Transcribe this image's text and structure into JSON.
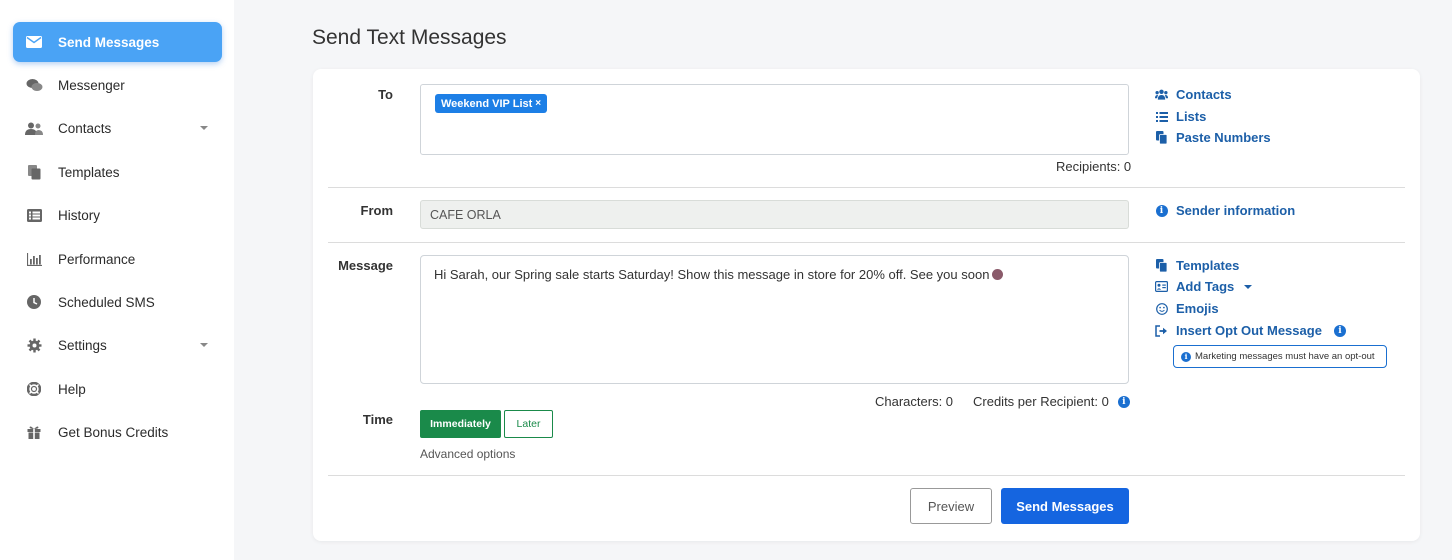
{
  "sidebar": {
    "items": [
      {
        "label": "Send Messages",
        "icon": "envelope-icon"
      },
      {
        "label": "Messenger",
        "icon": "chat-icon"
      },
      {
        "label": "Contacts",
        "icon": "users-icon"
      },
      {
        "label": "Templates",
        "icon": "copy-icon"
      },
      {
        "label": "History",
        "icon": "list-icon"
      },
      {
        "label": "Performance",
        "icon": "bar-chart-icon"
      },
      {
        "label": "Scheduled SMS",
        "icon": "clock-icon"
      },
      {
        "label": "Settings",
        "icon": "gear-icon"
      },
      {
        "label": "Help",
        "icon": "lifebuoy-icon"
      },
      {
        "label": "Get Bonus Credits",
        "icon": "gift-icon"
      }
    ]
  },
  "page": {
    "title": "Send Text Messages"
  },
  "form": {
    "to_label": "To",
    "recipient_tag": "Weekend VIP List",
    "recipient_tag_remove": "×",
    "recipients_count": "Recipients: 0",
    "from_label": "From",
    "from_value": "CAFE ORLA",
    "message_label": "Message",
    "message_text": "Hi Sarah, our Spring sale starts Saturday! Show this message in store for 20% off. See you soon",
    "characters": "Characters: 0",
    "credits": "Credits per Recipient: 0",
    "time_label": "Time",
    "time_immediately": "Immediately",
    "time_later": "Later",
    "advanced_options": "Advanced options",
    "preview_button": "Preview",
    "send_button": "Send Messages"
  },
  "side_links": {
    "contacts": "Contacts",
    "lists": "Lists",
    "paste_numbers": "Paste Numbers",
    "sender_information": "Sender information",
    "templates": "Templates",
    "add_tags": "Add Tags",
    "emojis": "Emojis",
    "insert_opt_out": "Insert Opt Out Message",
    "opt_out_note": "Marketing messages must have an opt-out"
  },
  "colors": {
    "active_nav": "#4aa3f5",
    "link": "#1c5fa8",
    "primary_button": "#1565e0",
    "green_button": "#1a8a4a"
  }
}
